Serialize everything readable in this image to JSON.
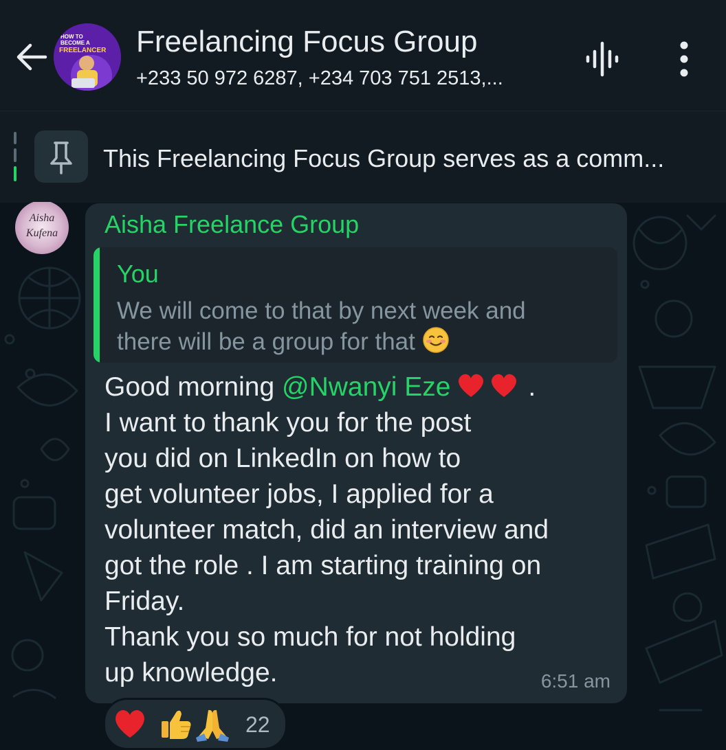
{
  "header": {
    "title": "Freelancing Focus Group",
    "subtitle": "+233 50 972 6287, +234 703 751 2513,...",
    "avatar_text": [
      "HOW TO",
      "BECOME A",
      "FREELANCER"
    ],
    "icons": [
      "back-arrow-icon",
      "voice-chat-icon",
      "more-options-icon"
    ]
  },
  "pinned": {
    "text": "This Freelancing Focus Group serves as a comm...",
    "icon": "pin-icon"
  },
  "message": {
    "sender": "Aisha Freelance Group",
    "sender_avatar_text": [
      "Aisha",
      "Kufena"
    ],
    "quote": {
      "author": "You",
      "text": "We will come to that by next week and\nthere will be a group for that"
    },
    "greeting": "Good morning ",
    "mention": "@Nwanyi Eze",
    "greeting_end": " .",
    "body": "I want to thank you for the post\nyou did on LinkedIn on how to\nget volunteer jobs, I applied for a\nvolunteer match, did an interview and\ngot the role . I am starting training on\nFriday.\nThank you so much for not holding\nup knowledge.",
    "time": "6:51 am"
  },
  "reactions": {
    "emojis": [
      "red-heart",
      "thumbs-up",
      "folded-hands"
    ],
    "count": "22"
  },
  "colors": {
    "background": "#0b141a",
    "header": "#121b22",
    "bubble": "#202c33",
    "accent_green": "#25d366",
    "muted_text": "#8696a0"
  }
}
